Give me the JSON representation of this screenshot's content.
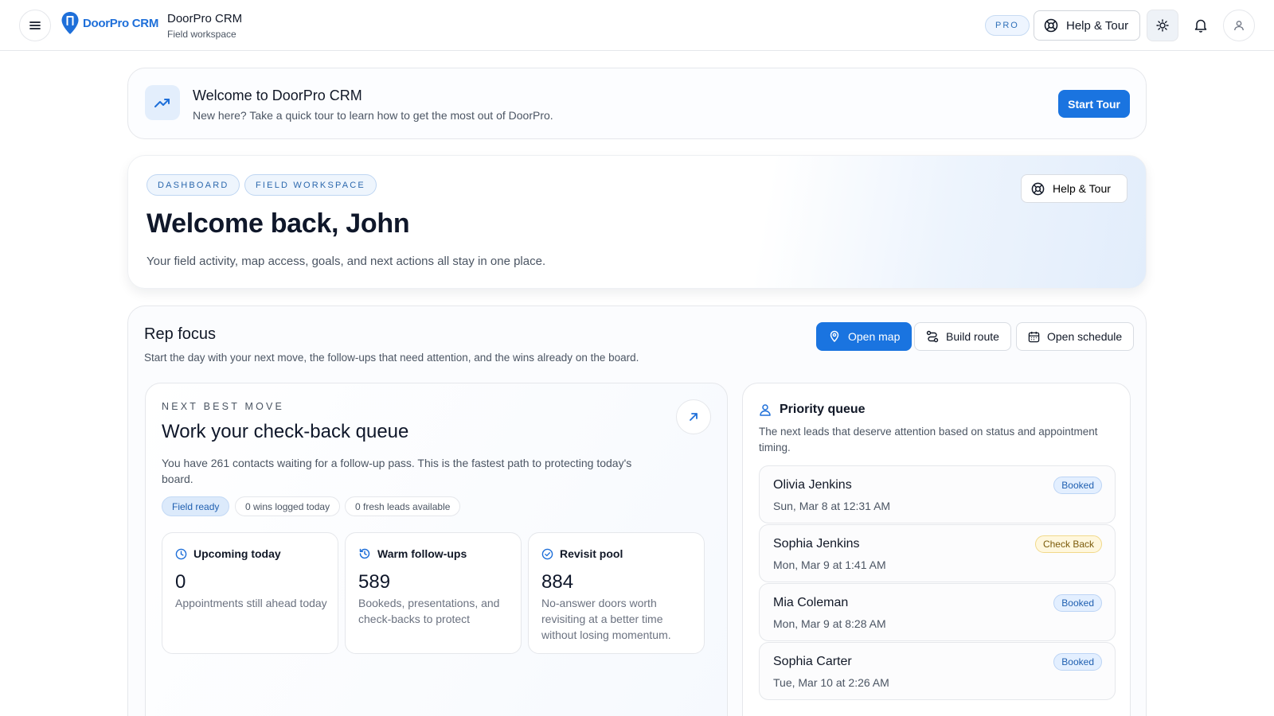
{
  "header": {
    "brand": "DoorPro CRM",
    "title": "DoorPro CRM",
    "subtitle": "Field workspace",
    "pro_badge": "PRO",
    "help_label": "Help & Tour",
    "icons": [
      "menu-icon",
      "logo-pin-icon",
      "lifebuoy-icon",
      "sun-icon",
      "bell-icon",
      "user-icon"
    ]
  },
  "banner": {
    "title": "Welcome to DoorPro CRM",
    "subtitle": "New here? Take a quick tour to learn how to get the most out of DoorPro.",
    "button": "Start Tour",
    "icon": "trending-up-icon"
  },
  "hero": {
    "chips": [
      "DASHBOARD",
      "FIELD WORKSPACE"
    ],
    "title": "Welcome back, John",
    "subtitle": "Your field activity, map access, goals, and next actions all stay in one place.",
    "help_label": "Help & Tour"
  },
  "rep_focus": {
    "title": "Rep focus",
    "subtitle": "Start the day with your next move, the follow-ups that need attention, and the wins already on the board.",
    "actions": {
      "open_map": "Open map",
      "build_route": "Build route",
      "open_schedule": "Open schedule"
    }
  },
  "next_best_move": {
    "eyebrow": "NEXT BEST MOVE",
    "title": "Work your check-back queue",
    "description": "You have 261 contacts waiting for a follow-up pass. This is the fastest path to protecting today's board.",
    "pills": [
      "Field ready",
      "0 wins logged today",
      "0 fresh leads available"
    ],
    "stats": [
      {
        "label": "Upcoming today",
        "value": "0",
        "description": "Appointments still ahead today",
        "icon": "clock-icon"
      },
      {
        "label": "Warm follow-ups",
        "value": "589",
        "description": "Bookeds, presentations, and check-backs to protect",
        "icon": "refresh-clock-icon"
      },
      {
        "label": "Revisit pool",
        "value": "884",
        "description": "No-answer doors worth revisiting at a better time without losing momentum.",
        "icon": "check-circle-icon"
      }
    ]
  },
  "priority_queue": {
    "title": "Priority queue",
    "subtitle": "The next leads that deserve attention based on status and appointment timing.",
    "leads": [
      {
        "name": "Olivia Jenkins",
        "time": "Sun, Mar 8 at 12:31 AM",
        "status": "Booked"
      },
      {
        "name": "Sophia Jenkins",
        "time": "Mon, Mar 9 at 1:41 AM",
        "status": "Check Back"
      },
      {
        "name": "Mia Coleman",
        "time": "Mon, Mar 9 at 8:28 AM",
        "status": "Booked"
      },
      {
        "name": "Sophia Carter",
        "time": "Tue, Mar 10 at 2:26 AM",
        "status": "Booked"
      }
    ]
  },
  "colors": {
    "accent": "#1a74e0",
    "booked": "#e3efff",
    "check_back": "#fff7dd"
  }
}
